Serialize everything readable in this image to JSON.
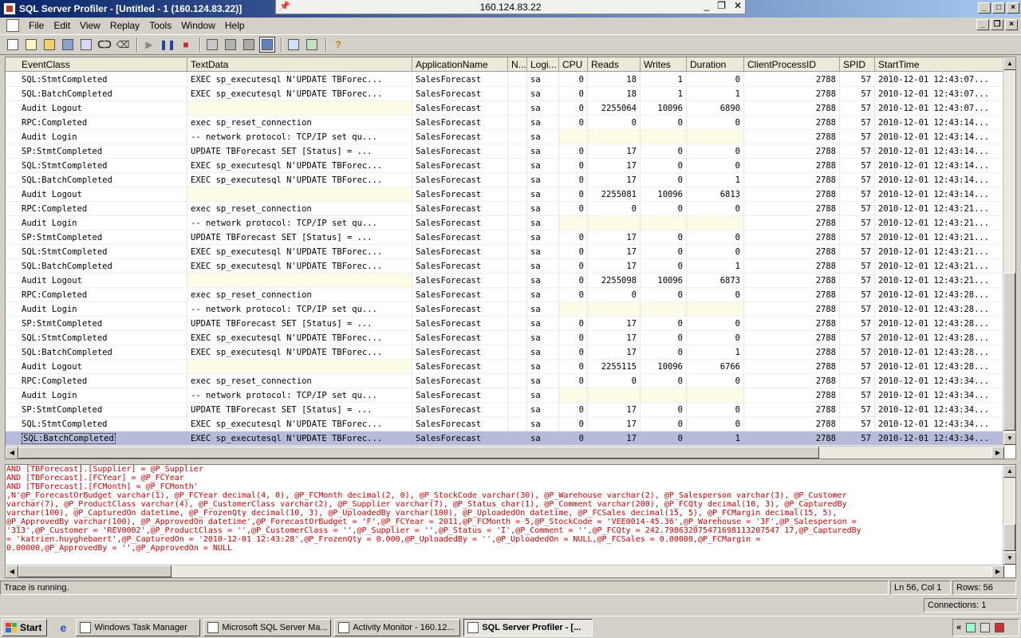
{
  "window": {
    "title": "SQL Server Profiler - [Untitled - 1 (160.124.83.22)]",
    "remote_host": "160.124.83.22"
  },
  "menu": [
    "File",
    "Edit",
    "View",
    "Replay",
    "Tools",
    "Window",
    "Help"
  ],
  "grid": {
    "columns": [
      {
        "label": "EventClass",
        "w": 212
      },
      {
        "label": "TextData",
        "w": 282
      },
      {
        "label": "ApplicationName",
        "w": 120
      },
      {
        "label": "N...",
        "w": 24
      },
      {
        "label": "Logi...",
        "w": 40
      },
      {
        "label": "CPU",
        "w": 36
      },
      {
        "label": "Reads",
        "w": 66
      },
      {
        "label": "Writes",
        "w": 58
      },
      {
        "label": "Duration",
        "w": 72
      },
      {
        "label": "ClientProcessID",
        "w": 120
      },
      {
        "label": "SPID",
        "w": 44
      },
      {
        "label": "StartTime",
        "w": 162
      }
    ],
    "rows": [
      [
        "SQL:StmtCompleted",
        "EXEC sp_executesql N'UPDATE TBForec...",
        "SalesForecast",
        "",
        "sa",
        "0",
        "18",
        "1",
        "0",
        "2788",
        "57",
        "2010-12-01 12:43:07..."
      ],
      [
        "SQL:BatchCompleted",
        "EXEC sp_executesql N'UPDATE TBForec...",
        "SalesForecast",
        "",
        "sa",
        "0",
        "18",
        "1",
        "1",
        "2788",
        "57",
        "2010-12-01 12:43:07..."
      ],
      [
        "Audit Logout",
        "",
        "SalesForecast",
        "",
        "sa",
        "0",
        "2255064",
        "10096",
        "6890",
        "2788",
        "57",
        "2010-12-01 12:43:07..."
      ],
      [
        "RPC:Completed",
        "exec sp_reset_connection",
        "SalesForecast",
        "",
        "sa",
        "0",
        "0",
        "0",
        "0",
        "2788",
        "57",
        "2010-12-01 12:43:14..."
      ],
      [
        "Audit Login",
        "-- network protocol: TCP/IP  set qu...",
        "SalesForecast",
        "",
        "sa",
        "",
        "",
        "",
        "",
        "2788",
        "57",
        "2010-12-01 12:43:14..."
      ],
      [
        "SP:StmtCompleted",
        "UPDATE TBForecast  SET  [Status] = ...",
        "SalesForecast",
        "",
        "sa",
        "0",
        "17",
        "0",
        "0",
        "2788",
        "57",
        "2010-12-01 12:43:14..."
      ],
      [
        "SQL:StmtCompleted",
        "EXEC sp_executesql N'UPDATE TBForec...",
        "SalesForecast",
        "",
        "sa",
        "0",
        "17",
        "0",
        "0",
        "2788",
        "57",
        "2010-12-01 12:43:14..."
      ],
      [
        "SQL:BatchCompleted",
        "EXEC sp_executesql N'UPDATE TBForec...",
        "SalesForecast",
        "",
        "sa",
        "0",
        "17",
        "0",
        "1",
        "2788",
        "57",
        "2010-12-01 12:43:14..."
      ],
      [
        "Audit Logout",
        "",
        "SalesForecast",
        "",
        "sa",
        "0",
        "2255081",
        "10096",
        "6813",
        "2788",
        "57",
        "2010-12-01 12:43:14..."
      ],
      [
        "RPC:Completed",
        "exec sp_reset_connection",
        "SalesForecast",
        "",
        "sa",
        "0",
        "0",
        "0",
        "0",
        "2788",
        "57",
        "2010-12-01 12:43:21..."
      ],
      [
        "Audit Login",
        "-- network protocol: TCP/IP  set qu...",
        "SalesForecast",
        "",
        "sa",
        "",
        "",
        "",
        "",
        "2788",
        "57",
        "2010-12-01 12:43:21..."
      ],
      [
        "SP:StmtCompleted",
        "UPDATE TBForecast  SET  [Status] = ...",
        "SalesForecast",
        "",
        "sa",
        "0",
        "17",
        "0",
        "0",
        "2788",
        "57",
        "2010-12-01 12:43:21..."
      ],
      [
        "SQL:StmtCompleted",
        "EXEC sp_executesql N'UPDATE TBForec...",
        "SalesForecast",
        "",
        "sa",
        "0",
        "17",
        "0",
        "0",
        "2788",
        "57",
        "2010-12-01 12:43:21..."
      ],
      [
        "SQL:BatchCompleted",
        "EXEC sp_executesql N'UPDATE TBForec...",
        "SalesForecast",
        "",
        "sa",
        "0",
        "17",
        "0",
        "1",
        "2788",
        "57",
        "2010-12-01 12:43:21..."
      ],
      [
        "Audit Logout",
        "",
        "SalesForecast",
        "",
        "sa",
        "0",
        "2255098",
        "10096",
        "6873",
        "2788",
        "57",
        "2010-12-01 12:43:21..."
      ],
      [
        "RPC:Completed",
        "exec sp_reset_connection",
        "SalesForecast",
        "",
        "sa",
        "0",
        "0",
        "0",
        "0",
        "2788",
        "57",
        "2010-12-01 12:43:28..."
      ],
      [
        "Audit Login",
        "-- network protocol: TCP/IP  set qu...",
        "SalesForecast",
        "",
        "sa",
        "",
        "",
        "",
        "",
        "2788",
        "57",
        "2010-12-01 12:43:28..."
      ],
      [
        "SP:StmtCompleted",
        "UPDATE TBForecast  SET  [Status] = ...",
        "SalesForecast",
        "",
        "sa",
        "0",
        "17",
        "0",
        "0",
        "2788",
        "57",
        "2010-12-01 12:43:28..."
      ],
      [
        "SQL:StmtCompleted",
        "EXEC sp_executesql N'UPDATE TBForec...",
        "SalesForecast",
        "",
        "sa",
        "0",
        "17",
        "0",
        "0",
        "2788",
        "57",
        "2010-12-01 12:43:28..."
      ],
      [
        "SQL:BatchCompleted",
        "EXEC sp_executesql N'UPDATE TBForec...",
        "SalesForecast",
        "",
        "sa",
        "0",
        "17",
        "0",
        "1",
        "2788",
        "57",
        "2010-12-01 12:43:28..."
      ],
      [
        "Audit Logout",
        "",
        "SalesForecast",
        "",
        "sa",
        "0",
        "2255115",
        "10096",
        "6766",
        "2788",
        "57",
        "2010-12-01 12:43:28..."
      ],
      [
        "RPC:Completed",
        "exec sp_reset_connection",
        "SalesForecast",
        "",
        "sa",
        "0",
        "0",
        "0",
        "0",
        "2788",
        "57",
        "2010-12-01 12:43:34..."
      ],
      [
        "Audit Login",
        "-- network protocol: TCP/IP  set qu...",
        "SalesForecast",
        "",
        "sa",
        "",
        "",
        "",
        "",
        "2788",
        "57",
        "2010-12-01 12:43:34..."
      ],
      [
        "SP:StmtCompleted",
        "UPDATE TBForecast  SET  [Status] = ...",
        "SalesForecast",
        "",
        "sa",
        "0",
        "17",
        "0",
        "0",
        "2788",
        "57",
        "2010-12-01 12:43:34..."
      ],
      [
        "SQL:StmtCompleted",
        "EXEC sp_executesql N'UPDATE TBForec...",
        "SalesForecast",
        "",
        "sa",
        "0",
        "17",
        "0",
        "0",
        "2788",
        "57",
        "2010-12-01 12:43:34..."
      ],
      [
        "SQL:BatchCompleted",
        "EXEC sp_executesql N'UPDATE TBForec...",
        "SalesForecast",
        "",
        "sa",
        "0",
        "17",
        "0",
        "1",
        "2788",
        "57",
        "2010-12-01 12:43:34..."
      ]
    ],
    "selected_row": 25
  },
  "detail": {
    "lines": [
      "AND [TBForecast].[Supplier] = @P_Supplier",
      "AND [TBForecast].[FCYear] = @P_FCYear",
      "AND [TBForecast].[FCMonth] = @P_FCMonth'",
      ",N'@P_ForecastOrBudget varchar(1), @P_FCYear decimal(4, 0), @P_FCMonth decimal(2, 0), @P_StockCode varchar(30), @P_Warehouse varchar(2), @P_Salesperson varchar(3), @P_Customer",
      "varchar(7), @P_ProductClass varchar(4), @P_CustomerClass varchar(2), @P_Supplier varchar(7), @P_Status char(1), @P_Comment varchar(200), @P_FCQty decimal(10, 3), @P_CapturedBy",
      "varchar(100), @P_CapturedOn datetime, @P_FrozenQty decimal(10, 3), @P_UploadedBy varchar(100), @P_UploadedOn datetime, @P_FCSales decimal(15, 5), @P_FCMargin decimal(15, 5),",
      "@P_ApprovedBy varchar(100), @P_ApprovedOn datetime',@P_ForecastOrBudget = 'F',@P_FCYear = 2011,@P_FCMonth = 5,@P_StockCode = 'VEE0014-45.36',@P_Warehouse = '3F',@P_Salesperson =",
      "'313',@P_Customer = 'REV0002',@P_ProductClass = '',@P_CustomerClass = '',@P_Supplier = '',@P_Status = 'I',@P_Comment = '',@P_FCQty = 242.798632075471698113207547 17,@P_CapturedBy",
      "= 'katrien.huyghebaert',@P_CapturedOn = '2010-12-01 12:43:28',@P_FrozenQty = 0.000,@P_UploadedBy = '',@P_UploadedOn = NULL,@P_FCSales = 0.00000,@P_FCMargin =",
      "0.00000,@P_ApprovedBy = '',@P_ApprovedOn = NULL"
    ]
  },
  "status": {
    "running": "Trace is running.",
    "position": "Ln 56, Col 1",
    "rows": "Rows: 56",
    "connections": "Connections: 1"
  },
  "taskbar": {
    "start": "Start",
    "tasks": [
      {
        "label": "Windows Task Manager",
        "w": 156
      },
      {
        "label": "Microsoft SQL Server Ma...",
        "w": 160
      },
      {
        "label": "Activity Monitor - 160.12...",
        "w": 158
      },
      {
        "label": "SQL Server Profiler - [...",
        "w": 162,
        "active": true
      }
    ]
  }
}
